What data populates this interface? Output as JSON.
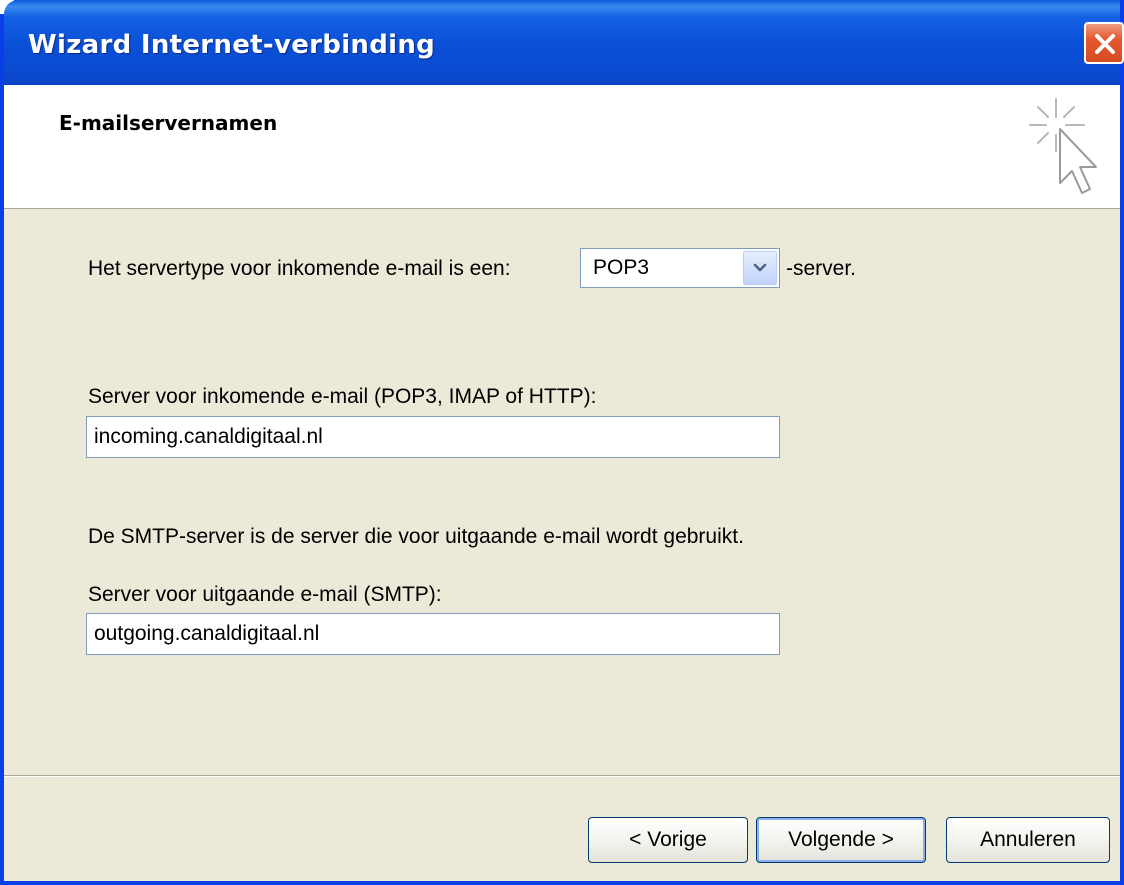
{
  "window": {
    "title": "Wizard Internet-verbinding"
  },
  "header": {
    "heading": "E-mailservernamen"
  },
  "form": {
    "server_type_label": "Het servertype voor inkomende e-mail is een:",
    "server_type_value": "POP3",
    "server_type_suffix": "-server.",
    "incoming_label": "Server voor inkomende e-mail (POP3, IMAP of HTTP):",
    "incoming_value": "incoming.canaldigitaal.nl",
    "smtp_info": "De SMTP-server is de server die voor uitgaande e-mail wordt gebruikt.",
    "outgoing_label": "Server voor uitgaande e-mail (SMTP):",
    "outgoing_value": "outgoing.canaldigitaal.nl"
  },
  "buttons": {
    "back": "< Vorige",
    "next": "Volgende >",
    "cancel": "Annuleren"
  },
  "icons": {
    "close": "close-icon",
    "wizard": "cursor-sparkle-icon",
    "dropdown": "chevron-down-icon"
  },
  "colors": {
    "titlebar": "#0a4fd6",
    "client_bg": "#ece9d8",
    "close_button": "#e4592f",
    "input_border": "#7f9db9"
  }
}
